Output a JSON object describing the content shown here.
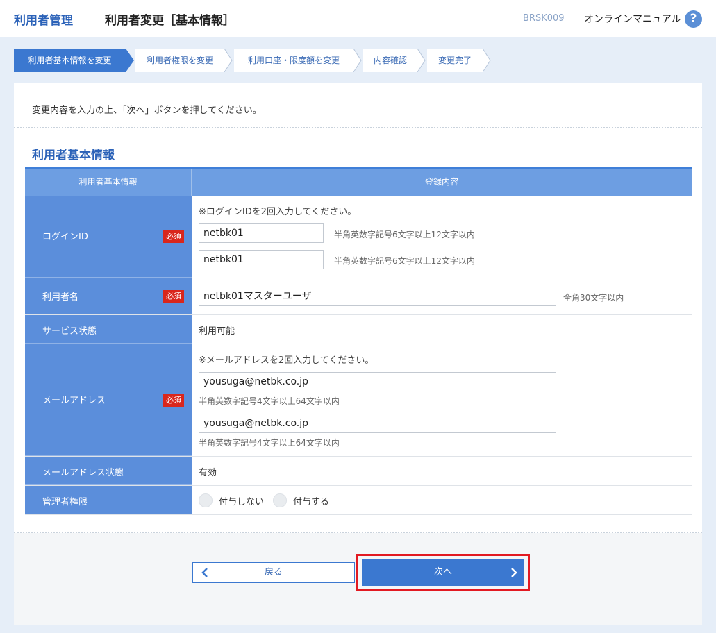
{
  "header": {
    "module": "利用者管理",
    "title": "利用者変更［基本情報］",
    "screen_code": "BRSK009",
    "manual_link": "オンラインマニュアル",
    "help_icon": "?"
  },
  "steps": [
    {
      "label": "利用者基本情報を変更",
      "active": true
    },
    {
      "label": "利用者権限を変更",
      "active": false
    },
    {
      "label": "利用口座・限度額を変更",
      "active": false
    },
    {
      "label": "内容確認",
      "active": false
    },
    {
      "label": "変更完了",
      "active": false
    }
  ],
  "intro": "変更内容を入力の上、「次へ」ボタンを押してください。",
  "section_title": "利用者基本情報",
  "table": {
    "col1": "利用者基本情報",
    "col2": "登録内容",
    "required_badge": "必須",
    "login": {
      "label": "ログインID",
      "note": "※ログインIDを2回入力してください。",
      "value1": "netbk01",
      "value2": "netbk01",
      "hint": "半角英数字記号6文字以上12文字以内"
    },
    "username": {
      "label": "利用者名",
      "value": "netbk01マスターユーザ",
      "hint": "全角30文字以内"
    },
    "service": {
      "label": "サービス状態",
      "value": "利用可能"
    },
    "email": {
      "label": "メールアドレス",
      "note": "※メールアドレスを2回入力してください。",
      "value1": "yousuga@netbk.co.jp",
      "value2": "yousuga@netbk.co.jp",
      "hint": "半角英数字記号4文字以上64文字以内"
    },
    "email_status": {
      "label": "メールアドレス状態",
      "value": "有効"
    },
    "admin": {
      "label": "管理者権限",
      "option1": "付与しない",
      "option2": "付与する"
    }
  },
  "buttons": {
    "back": "戻る",
    "next": "次へ"
  },
  "colors": {
    "accent": "#3b78d0",
    "label_bg": "#5b8edb",
    "required": "#d9261c",
    "highlight": "#e21a22"
  }
}
